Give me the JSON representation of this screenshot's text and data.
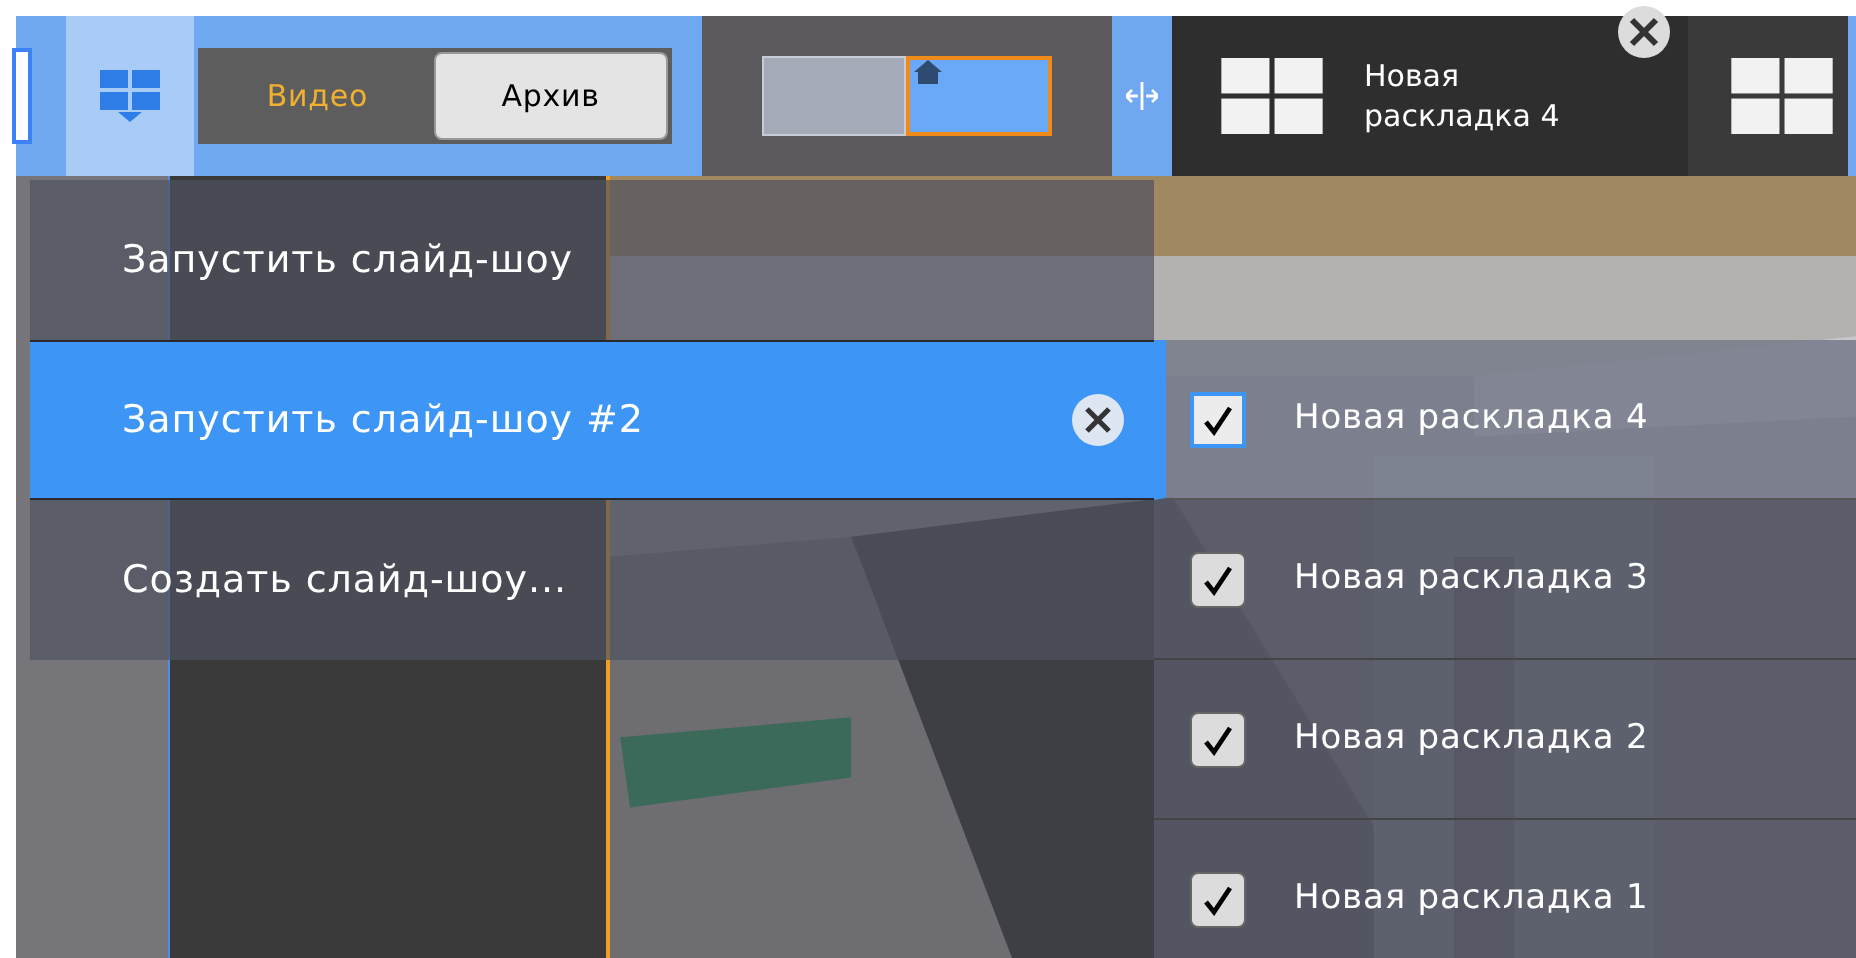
{
  "toolbar": {
    "mode_tabs": [
      {
        "label": "Видео",
        "selected": true
      },
      {
        "label": "Архив",
        "selected": false
      }
    ],
    "layout_tabs": [
      {
        "title": "Новая\nраскладка 4",
        "selected": true
      },
      {
        "selected": false
      }
    ]
  },
  "menu": {
    "items": [
      {
        "label": "Запустить слайд-шоу",
        "selected": false,
        "removable": false
      },
      {
        "label": "Запустить слайд-шоу #2",
        "selected": true,
        "removable": true
      },
      {
        "label": "Создать слайд-шоу...",
        "selected": false,
        "removable": false
      }
    ]
  },
  "submenu": {
    "items": [
      {
        "label": "Новая раскладка 4",
        "checked": true,
        "selected": true
      },
      {
        "label": "Новая раскладка 3",
        "checked": true,
        "selected": false
      },
      {
        "label": "Новая раскладка 2",
        "checked": true,
        "selected": false
      },
      {
        "label": "Новая раскладка 1",
        "checked": true,
        "selected": false
      }
    ]
  }
}
